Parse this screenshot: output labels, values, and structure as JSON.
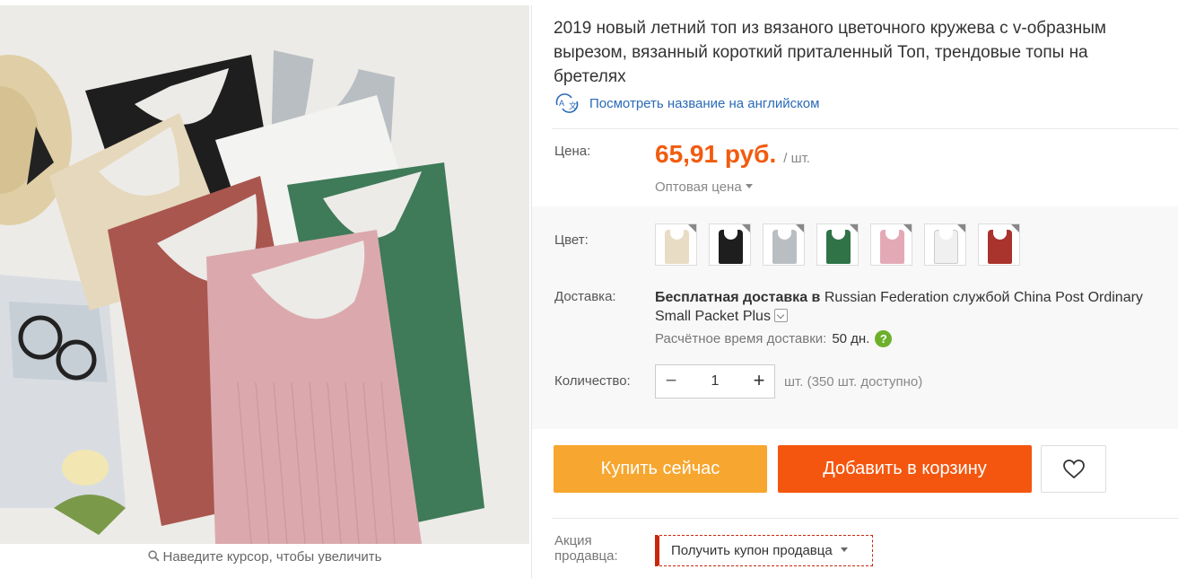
{
  "product": {
    "title": "2019 новый летний топ из вязаного цветочного кружева с v-образным вырезом, вязанный короткий приталенный Топ, трендовые топы на бретелях",
    "translate_link": "Посмотреть название на английском",
    "translate_icon": "translate-icon"
  },
  "gallery": {
    "zoom_hint": "Наведите курсор, чтобы увеличить",
    "zoom_icon": "magnifier-icon"
  },
  "price": {
    "label": "Цена:",
    "amount": "65,91 руб.",
    "unit": "/ шт.",
    "wholesale": "Оптовая цена"
  },
  "color": {
    "label": "Цвет:",
    "swatches": [
      {
        "name": "beige",
        "hex": "#e8dcc4"
      },
      {
        "name": "black",
        "hex": "#1e1e1e"
      },
      {
        "name": "gray",
        "hex": "#b9bec3"
      },
      {
        "name": "green",
        "hex": "#2f7347"
      },
      {
        "name": "pink",
        "hex": "#e3aab6"
      },
      {
        "name": "white",
        "hex": "#f0f0f0"
      },
      {
        "name": "red",
        "hex": "#a9332d"
      }
    ]
  },
  "delivery": {
    "label": "Доставка:",
    "free_text": "Бесплатная доставка в",
    "destination_text": "Russian Federation службой China Post Ordinary Small Packet Plus",
    "eta_label": "Расчётное время доставки:",
    "eta_value": "50 дн.",
    "help": "?"
  },
  "quantity": {
    "label": "Количество:",
    "value": "1",
    "minus": "−",
    "plus": "+",
    "available": "шт. (350 шт. доступно)"
  },
  "actions": {
    "buy_now": "Купить сейчас",
    "add_to_cart": "Добавить в корзину",
    "wishlist_icon": "heart-icon"
  },
  "promo": {
    "label_line1": "Акция",
    "label_line2": "продавца:",
    "coupon": "Получить купон продавца"
  },
  "colors": {
    "price": "#f25b0f",
    "buy_now_bg": "#f7a62f",
    "add_to_cart_bg": "#f4560f",
    "link": "#2a6ab7",
    "coupon_border": "#c7280b"
  }
}
